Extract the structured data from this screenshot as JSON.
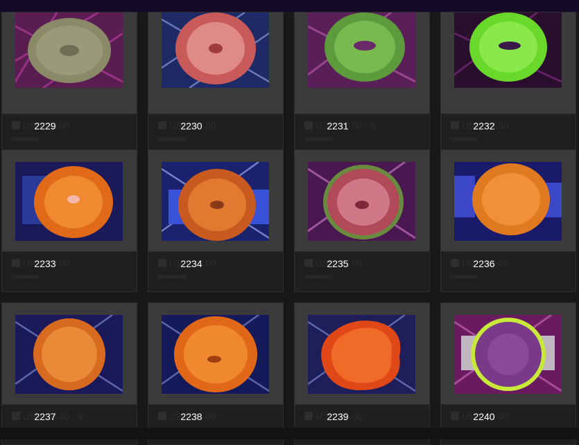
{
  "products": [
    {
      "number": "2229",
      "price_ghost": "USD. 20.00 - ..."
    },
    {
      "number": "2230",
      "price_ghost": "USD. 20.00 - ..."
    },
    {
      "number": "2231",
      "price_ghost": "USD. 20.00 - 0..."
    },
    {
      "number": "2232",
      "price_ghost": "USD. 20.00 - ..."
    },
    {
      "number": "2233",
      "price_ghost": "USD. 25.00 - ..."
    },
    {
      "number": "2234",
      "price_ghost": "USD. 25.00 - ..."
    },
    {
      "number": "2235",
      "price_ghost": "USD. 25.00 - ..."
    },
    {
      "number": "2236",
      "price_ghost": "USD. 25.00 - ..."
    },
    {
      "number": "2237",
      "price_ghost": "USD. 25.00 - 0..."
    },
    {
      "number": "2238",
      "price_ghost": "USD. 25.00 - ..."
    },
    {
      "number": "2239",
      "price_ghost": "USD. 25.00 - ..."
    },
    {
      "number": "2240",
      "price_ghost": "USD. 25.00 - ..."
    }
  ],
  "colors": {
    "page_bg": "#181818",
    "top_bar": "#140a28",
    "photo_frame": "#3b3b3b",
    "label_text": "#ffffff"
  }
}
